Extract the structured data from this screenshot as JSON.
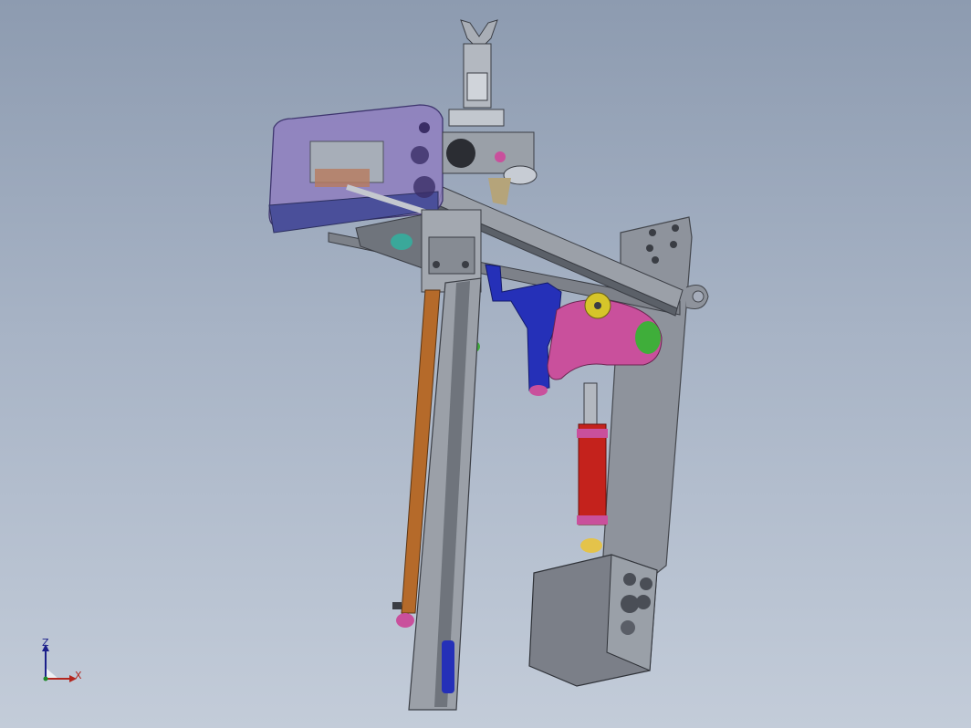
{
  "viewport": {
    "background_top": "#8d9bb0",
    "background_bottom": "#c3ccd9"
  },
  "model": {
    "parts": [
      "top-gripper",
      "gripper-cylinder",
      "valve-manifold-cover",
      "horizontal-beam",
      "carriage-plate",
      "vertical-rail",
      "long-cylinder",
      "blue-bracket",
      "pink-cam-link",
      "red-cylinder",
      "backing-plate",
      "control-box"
    ],
    "colors": {
      "steel": "#8e939c",
      "steel_dark": "#5b6068",
      "cover": "#8f7fbf",
      "manifold_base": "#4a4f9a",
      "blue_bracket": "#2530b8",
      "pink_link": "#c9509c",
      "red_cylinder": "#c4221c",
      "orange_cylinder": "#b56a2a",
      "yellow_wheel": "#d6c52a",
      "green_wheel": "#3fae3a",
      "box": "#7b7f88"
    }
  },
  "triad": {
    "z_label": "Z",
    "x_label": "X",
    "z_color": "#1b1f8a",
    "x_color": "#b3261e"
  }
}
